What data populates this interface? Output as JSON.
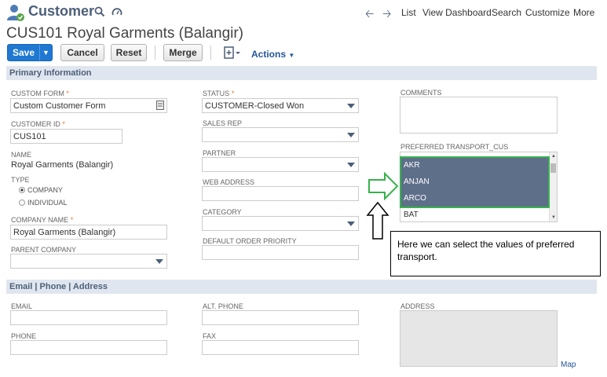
{
  "header": {
    "record_type": "Customer",
    "nav": [
      "List",
      "View Dashboard",
      "Search",
      "Customize",
      "More"
    ]
  },
  "record_title": "CUS101 Royal Garments (Balangir)",
  "toolbar": {
    "save_label": "Save",
    "cancel_label": "Cancel",
    "reset_label": "Reset",
    "merge_label": "Merge",
    "actions_label": "Actions"
  },
  "sections": {
    "primary": "Primary Information",
    "contact": "Email | Phone | Address"
  },
  "fields": {
    "custom_form": {
      "label": "CUSTOM FORM",
      "value": "Custom Customer Form"
    },
    "customer_id": {
      "label": "CUSTOMER ID",
      "value": "CUS101"
    },
    "name": {
      "label": "NAME",
      "value": "Royal Garments (Balangir)"
    },
    "type": {
      "label": "TYPE",
      "options": [
        "COMPANY",
        "INDIVIDUAL"
      ],
      "selected": "COMPANY"
    },
    "company_name": {
      "label": "COMPANY NAME",
      "value": "Royal Garments (Balangir)"
    },
    "parent_company": {
      "label": "PARENT COMPANY",
      "value": ""
    },
    "status": {
      "label": "STATUS",
      "value": "CUSTOMER-Closed Won"
    },
    "sales_rep": {
      "label": "SALES REP",
      "value": ""
    },
    "partner": {
      "label": "PARTNER",
      "value": ""
    },
    "web_address": {
      "label": "WEB ADDRESS",
      "value": ""
    },
    "category": {
      "label": "CATEGORY",
      "value": ""
    },
    "default_order_priority": {
      "label": "DEFAULT ORDER PRIORITY",
      "value": ""
    },
    "comments": {
      "label": "COMMENTS",
      "value": ""
    },
    "preferred_transport": {
      "label": "PREFERRED TRANSPORT_CUS",
      "options": [
        "AKR",
        "ANJAN",
        "ARCO",
        "BAT"
      ],
      "selected": [
        "AKR",
        "ANJAN",
        "ARCO"
      ]
    },
    "email": {
      "label": "EMAIL",
      "value": ""
    },
    "phone": {
      "label": "PHONE",
      "value": ""
    },
    "alt_phone": {
      "label": "ALT. PHONE",
      "value": ""
    },
    "fax": {
      "label": "FAX",
      "value": ""
    },
    "address": {
      "label": "ADDRESS",
      "value": ""
    }
  },
  "callout_text": "Here we can select the values of preferred transport.",
  "map_link": "Map",
  "colors": {
    "accent": "#1f78d1",
    "section_bg": "#e0e6ef",
    "selected_option": "#5e6f8a",
    "highlight": "#37b24d"
  }
}
